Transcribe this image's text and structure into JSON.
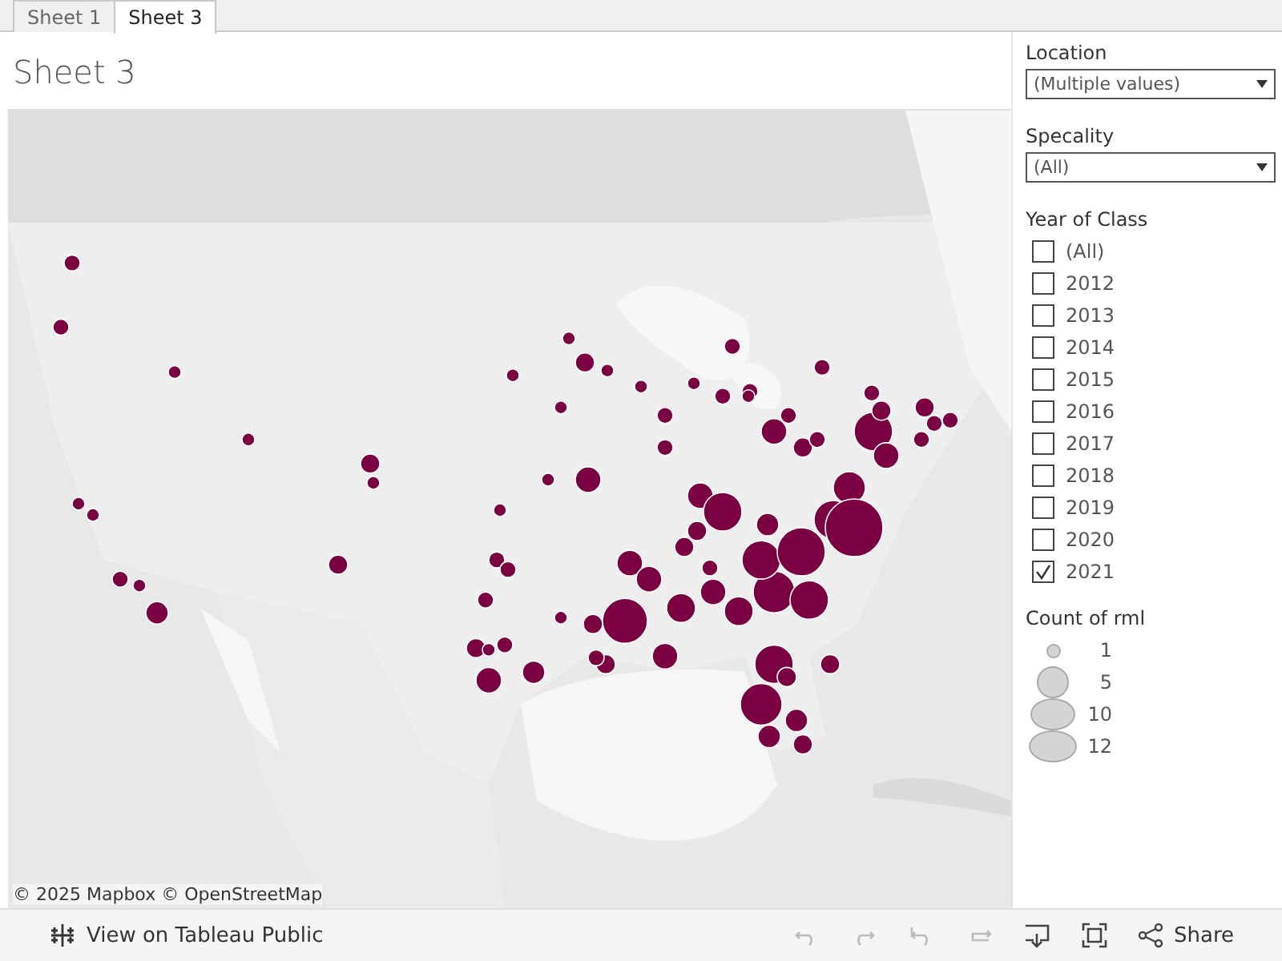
{
  "tabs": [
    {
      "label": "Sheet 1",
      "selected": false
    },
    {
      "label": "Sheet 3",
      "selected": true
    }
  ],
  "sheet": {
    "title": "Sheet 3",
    "map": {
      "kind": "picture",
      "attribution": "© 2025 Mapbox © OpenStreetMap"
    }
  },
  "filters": [
    {
      "label": "Location",
      "value": "(Multiple values)"
    },
    {
      "label": "Specality",
      "value": "(All)"
    }
  ],
  "year_filter": {
    "label": "Year of Class",
    "options": [
      {
        "label": "(All)",
        "checked": false
      },
      {
        "label": "2012",
        "checked": false
      },
      {
        "label": "2013",
        "checked": false
      },
      {
        "label": "2014",
        "checked": false
      },
      {
        "label": "2015",
        "checked": false
      },
      {
        "label": "2016",
        "checked": false
      },
      {
        "label": "2017",
        "checked": false
      },
      {
        "label": "2018",
        "checked": false
      },
      {
        "label": "2019",
        "checked": false
      },
      {
        "label": "2020",
        "checked": false
      },
      {
        "label": "2021",
        "checked": true
      }
    ]
  },
  "size_legend": {
    "title": "Count of rml",
    "items": [
      "1",
      "5",
      "10",
      "12"
    ]
  },
  "toolbar": {
    "view_link": "View on Tableau Public",
    "share": "Share"
  }
}
